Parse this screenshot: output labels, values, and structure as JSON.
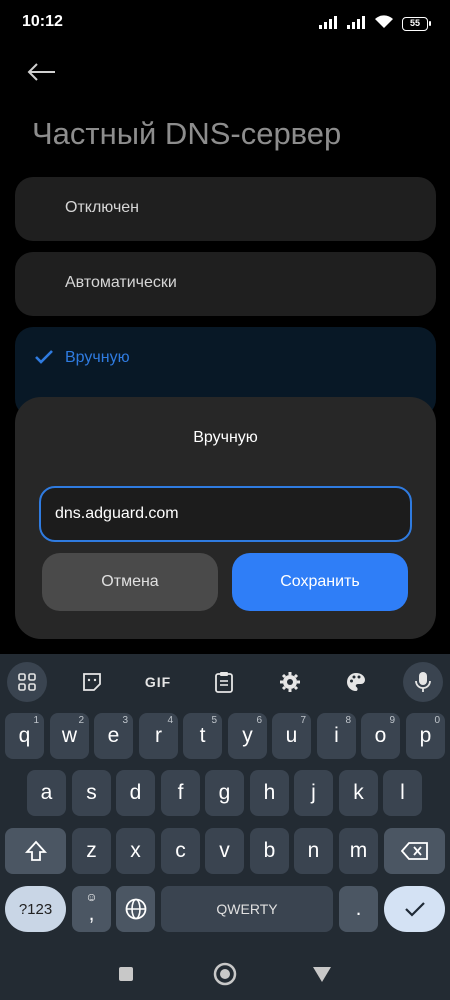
{
  "status": {
    "time": "10:12",
    "battery": "55"
  },
  "header": {
    "title": "Частный DNS-сервер"
  },
  "options": [
    {
      "label": "Отключен",
      "selected": false
    },
    {
      "label": "Автоматически",
      "selected": false
    },
    {
      "label": "Вручную",
      "selected": true
    }
  ],
  "dialog": {
    "title": "Вручную",
    "input_value": "dns.adguard.com",
    "cancel_label": "Отмена",
    "save_label": "Сохранить"
  },
  "keyboard": {
    "toolbar": {
      "gif_label": "GIF"
    },
    "row1": [
      "q",
      "w",
      "e",
      "r",
      "t",
      "y",
      "u",
      "i",
      "o",
      "p"
    ],
    "row1_alt": [
      "1",
      "2",
      "3",
      "4",
      "5",
      "6",
      "7",
      "8",
      "9",
      "0"
    ],
    "row2": [
      "a",
      "s",
      "d",
      "f",
      "g",
      "h",
      "j",
      "k",
      "l"
    ],
    "row3": [
      "z",
      "x",
      "c",
      "v",
      "b",
      "n",
      "m"
    ],
    "num_label": "?123",
    "comma": ",",
    "space_label": "QWERTY",
    "period": "."
  },
  "colors": {
    "accent": "#2f7be0",
    "save_button": "#2f7ef7",
    "keyboard_bg": "#232b33"
  }
}
